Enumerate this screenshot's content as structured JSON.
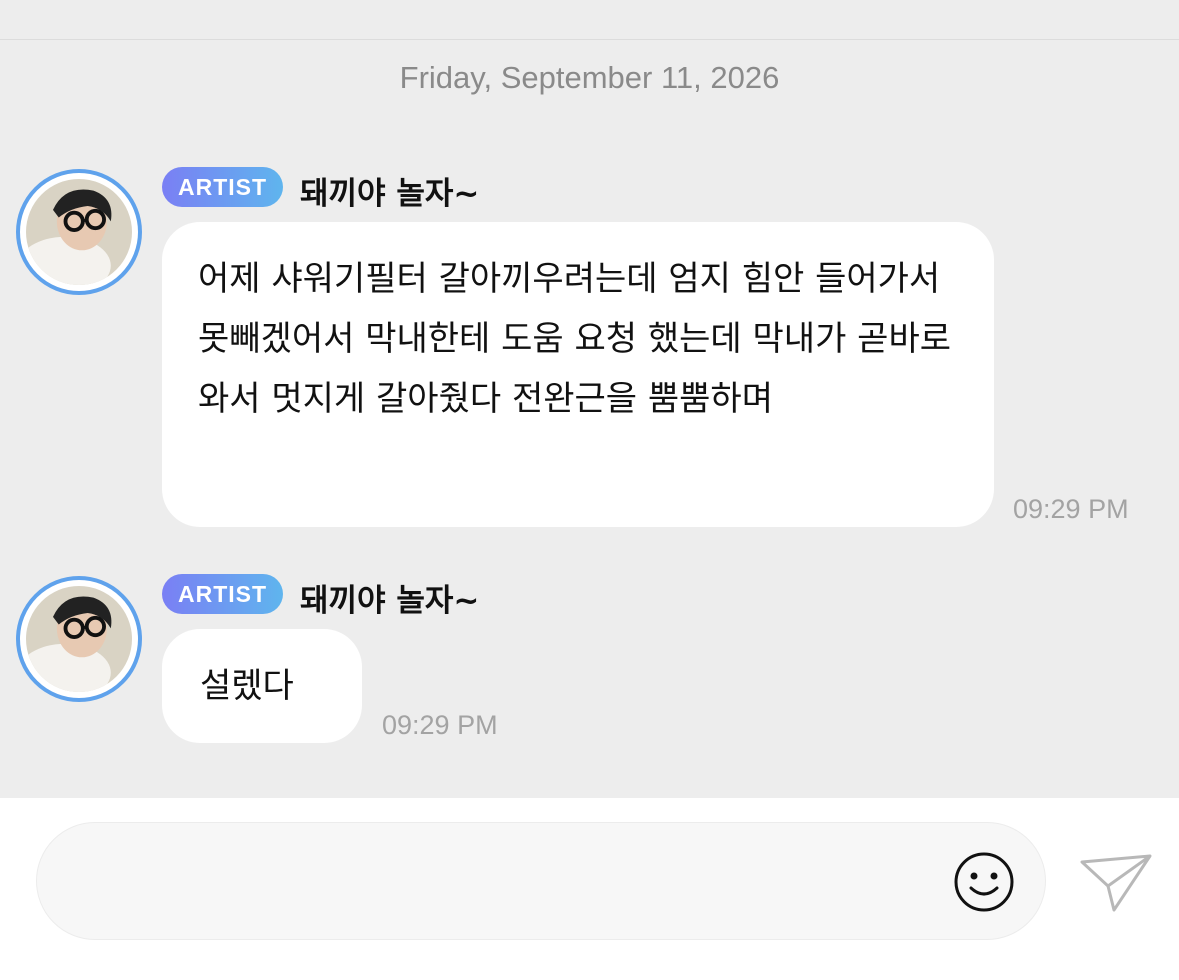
{
  "chat": {
    "date_divider": "Friday, September 11, 2026",
    "messages": [
      {
        "badge": "ARTIST",
        "sender": "돼끼야 놀자~",
        "text": "어제 샤워기필터 갈아끼우려는데 엄지 힘안 들어가서 못빼겠어서 막내한테 도움 요청 했는데 막내가 곧바로와서 멋지게 갈아줬다 전완근을 뿜뿜하며",
        "time": "09:29 PM"
      },
      {
        "badge": "ARTIST",
        "sender": "돼끼야 놀자~",
        "text": "설렜다",
        "time": "09:29 PM"
      }
    ]
  },
  "composer": {
    "emoji_icon": "smiley-face-icon",
    "send_icon": "paper-plane-icon"
  },
  "colors": {
    "background": "#ededed",
    "bubble": "#ffffff",
    "badge_gradient_start": "#7a7ff4",
    "badge_gradient_end": "#5fb5ee",
    "avatar_ring": "#5fa2ec"
  }
}
